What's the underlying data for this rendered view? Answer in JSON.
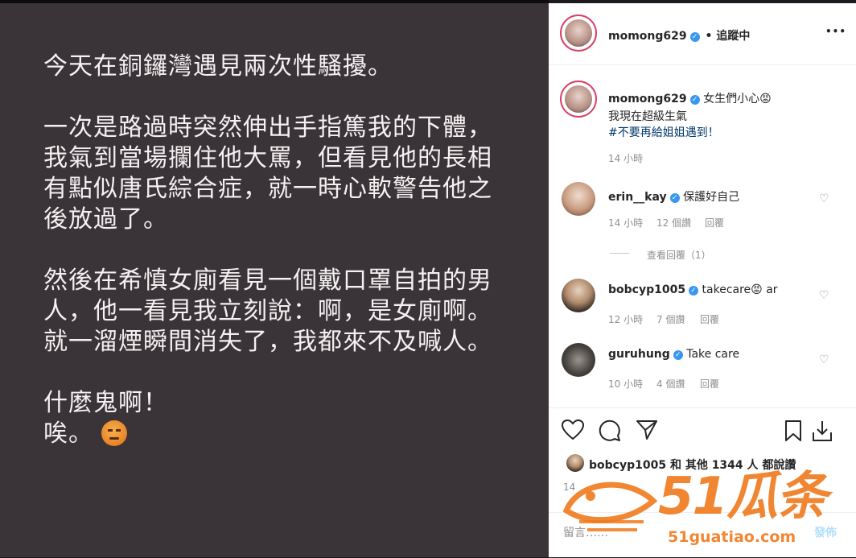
{
  "story": {
    "paragraphs": [
      "今天在銅鑼灣遇見兩次性騷擾。",
      "一次是路過時突然伸出手指篤我的下體，我氣到當場攔住他大罵，但看見他的長相有點似唐氏綜合症，就一時心軟警告他之後放過了。",
      "然後在希慎女廁看見一個戴口罩自拍的男人，他一看見我立刻說：啊，是女廁啊。就一溜煙瞬間消失了，我都來不及喊人。",
      "什麼鬼啊！",
      "唉。"
    ]
  },
  "header": {
    "username": "momong629",
    "follow_label": "• 追蹤中",
    "more_label": "•••"
  },
  "caption": {
    "username": "momong629",
    "text": "女生們小心😡",
    "line2": "我現在超級生氣",
    "line3": "#不要再給姐姐遇到！",
    "time": "14 小時"
  },
  "comments": [
    {
      "username": "erin__kay",
      "text": "保護好自己",
      "time": "14 小時",
      "likes": "12 個讚",
      "reply": "回覆"
    },
    {
      "username": "bobcyp1005",
      "text": "takecare😡 ar",
      "time": "12 小時",
      "likes": "7 個讚",
      "reply": "回覆"
    },
    {
      "username": "guruhung",
      "text": "Take care",
      "time": "10 小時",
      "likes": "4 個讚",
      "reply": "回覆"
    }
  ],
  "view_replies": "查看回覆（1）",
  "likes_line": "bobcyp1005 和 其他 1344 人 都說讚",
  "likes_time": "14",
  "comment_bar": {
    "placeholder": "留言……",
    "post_label": "發佈"
  },
  "watermark": {
    "brand": "51瓜条",
    "url": "51guatiao.com"
  },
  "colors": {
    "story_bg": "#3a3337",
    "link_blue": "#00376b",
    "verified_blue": "#3897f0",
    "watermark_orange": "#f07a1c"
  }
}
